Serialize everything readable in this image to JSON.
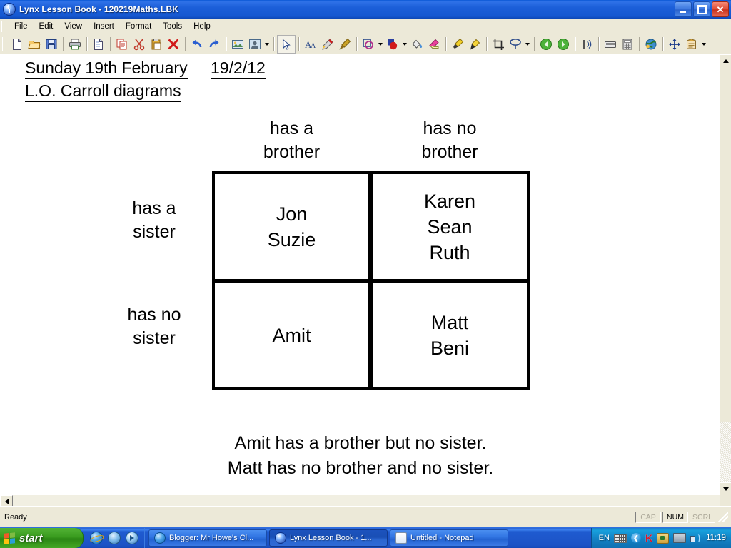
{
  "window": {
    "title": "Lynx Lesson Book - 120219Maths.LBK",
    "app_icon": "lynx-globe-icon",
    "buttons": {
      "minimize": "minimize-button",
      "maximize": "maximize-button",
      "close": "close-button",
      "close_glyph": "✕"
    }
  },
  "menu": {
    "items": [
      "File",
      "Edit",
      "View",
      "Insert",
      "Format",
      "Tools",
      "Help"
    ]
  },
  "toolbar": {
    "groups": [
      {
        "buttons": [
          {
            "name": "new-document-icon",
            "label": "New"
          },
          {
            "name": "open-folder-icon",
            "label": "Open"
          },
          {
            "name": "save-disk-icon",
            "label": "Save"
          }
        ]
      },
      {
        "buttons": [
          {
            "name": "print-icon",
            "label": "Print"
          }
        ]
      },
      {
        "buttons": [
          {
            "name": "new-page-icon",
            "label": "New Page"
          }
        ]
      },
      {
        "buttons": [
          {
            "name": "copy-icon",
            "label": "Copy"
          },
          {
            "name": "cut-scissors-icon",
            "label": "Cut"
          },
          {
            "name": "paste-clipboard-icon",
            "label": "Paste"
          },
          {
            "name": "delete-cross-icon",
            "label": "Delete"
          }
        ]
      },
      {
        "buttons": [
          {
            "name": "undo-arrow-icon",
            "label": "Undo"
          },
          {
            "name": "redo-arrow-icon",
            "label": "Redo"
          }
        ]
      },
      {
        "buttons": [
          {
            "name": "insert-picture-icon",
            "label": "Insert Picture"
          },
          {
            "name": "insert-portrait-icon",
            "label": "Insert Object"
          }
        ],
        "dropdown": true
      },
      {
        "buttons": [
          {
            "name": "select-pointer-icon",
            "label": "Select",
            "selected": true
          }
        ]
      },
      {
        "buttons": [
          {
            "name": "text-tool-icon",
            "label": "Text"
          },
          {
            "name": "pen-tool-icon",
            "label": "Pen"
          },
          {
            "name": "brush-tool-icon",
            "label": "Brush"
          }
        ]
      },
      {
        "buttons": [
          {
            "name": "shape-outline-icon",
            "label": "Shapes"
          },
          {
            "name": "fill-shape-icon",
            "label": "Filled Shape"
          },
          {
            "name": "paint-bucket-icon",
            "label": "Fill"
          },
          {
            "name": "eraser-icon",
            "label": "Eraser"
          }
        ]
      },
      {
        "buttons": [
          {
            "name": "highlighter-icon",
            "label": "Highlighter"
          },
          {
            "name": "marker-icon",
            "label": "Marker"
          }
        ]
      },
      {
        "buttons": [
          {
            "name": "crop-icon",
            "label": "Crop"
          },
          {
            "name": "spotlight-icon",
            "label": "Spotlight"
          }
        ]
      },
      {
        "buttons": [
          {
            "name": "previous-page-icon",
            "label": "Previous Page"
          },
          {
            "name": "next-page-icon",
            "label": "Next Page"
          }
        ]
      },
      {
        "buttons": [
          {
            "name": "wireless-signal-icon",
            "label": "Wireless"
          }
        ]
      },
      {
        "buttons": [
          {
            "name": "onscreen-keyboard-icon",
            "label": "On-screen Keyboard"
          },
          {
            "name": "calculator-icon",
            "label": "Calculator"
          }
        ]
      },
      {
        "buttons": [
          {
            "name": "globe-internet-icon",
            "label": "Internet"
          }
        ]
      },
      {
        "buttons": [
          {
            "name": "move-tool-icon",
            "label": "Move"
          },
          {
            "name": "lesson-notes-icon",
            "label": "Lesson Notes"
          }
        ]
      }
    ]
  },
  "page": {
    "heading_date": "Sunday 19th February",
    "heading_short_date": "19/2/12",
    "heading_objective": "L.O. Carroll diagrams",
    "carroll_diagram": {
      "column_headers": [
        "has a\nbrother",
        "has no\nbrother"
      ],
      "column_header_1_line1": "has a",
      "column_header_1_line2": "brother",
      "column_header_2_line1": "has no",
      "column_header_2_line2": "brother",
      "row_header_1_line1": "has a",
      "row_header_1_line2": "sister",
      "row_header_2_line1": "has no",
      "row_header_2_line2": "sister",
      "cells": {
        "brother_sister": [
          "Jon",
          "Suzie"
        ],
        "no_brother_sister": [
          "Karen",
          "Sean",
          "Ruth"
        ],
        "brother_no_sister": [
          "Amit"
        ],
        "no_brother_no_sister": [
          "Matt",
          "Beni"
        ]
      },
      "cell_text": {
        "tl": "Jon\nSuzie",
        "tr": "Karen\nSean\nRuth",
        "bl": "Amit",
        "br": "Matt\nBeni"
      }
    },
    "notes": {
      "line1": "Amit has a brother but no sister.",
      "line2": "Matt has no brother and no sister."
    }
  },
  "statusbar": {
    "message": "Ready",
    "indicators": [
      {
        "label": "CAP",
        "active": false
      },
      {
        "label": "NUM",
        "active": true
      },
      {
        "label": "SCRL",
        "active": false
      }
    ]
  },
  "taskbar": {
    "start_label": "start",
    "quicklaunch": [
      {
        "name": "internet-explorer-icon"
      },
      {
        "name": "show-desktop-icon"
      },
      {
        "name": "media-player-icon"
      }
    ],
    "tasks": [
      {
        "label": "Blogger: Mr Howe's Cl...",
        "icon": "internet-explorer-icon",
        "active": false
      },
      {
        "label": "Lynx Lesson Book - 1...",
        "icon": "lynx-globe-icon",
        "active": true
      },
      {
        "label": "Untitled - Notepad",
        "icon": "notepad-icon",
        "active": false
      }
    ],
    "tray": {
      "language": "EN",
      "icons": [
        "onscreen-keyboard-icon",
        "show-hidden-icons-chevron",
        "kaspersky-k-icon",
        "security-center-icon",
        "network-activity-icon",
        "volume-icon"
      ],
      "chevron_glyph": "❮",
      "k_glyph": "K",
      "clock": "11:19"
    }
  },
  "colors": {
    "titlebar_blue": "#1558d0",
    "chrome": "#ece9d8",
    "taskbar_blue": "#1c53c6",
    "start_green": "#399b1e",
    "page_white": "#ffffff",
    "ink_black": "#000000"
  }
}
